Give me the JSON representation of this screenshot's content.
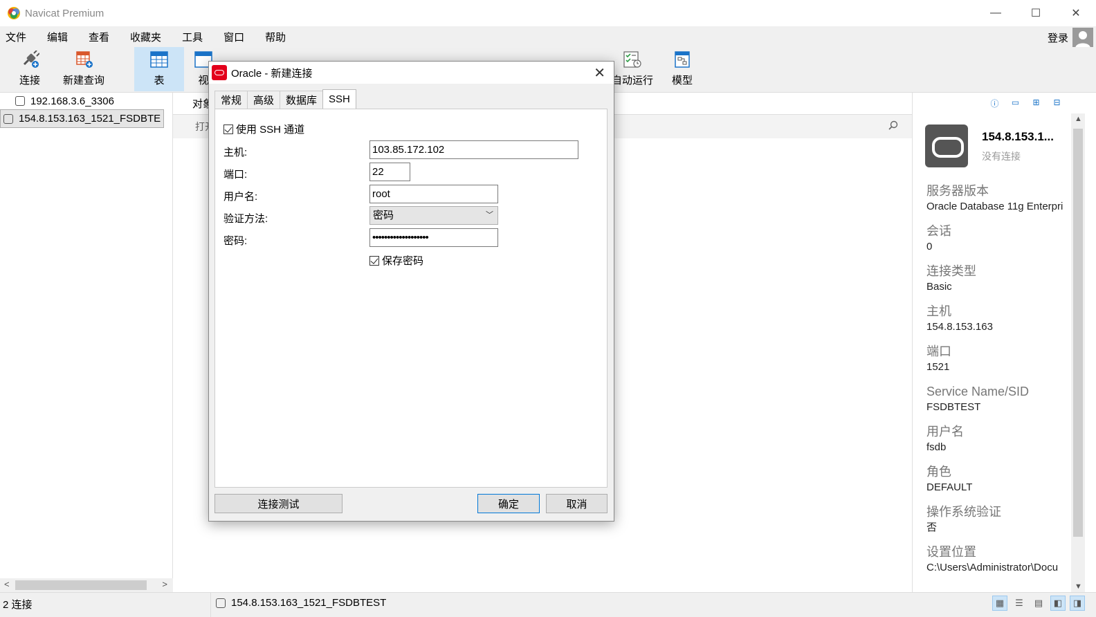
{
  "window": {
    "title": "Navicat Premium",
    "controls": [
      "—",
      "☐",
      "✕"
    ]
  },
  "menu": {
    "items": [
      "文件",
      "编辑",
      "查看",
      "收藏夹",
      "工具",
      "窗口",
      "帮助"
    ],
    "login": "登录"
  },
  "toolbar": {
    "items": [
      {
        "label": "连接"
      },
      {
        "label": "新建查询"
      },
      {
        "label": "表"
      },
      {
        "label": "视"
      },
      {
        "label": "自动运行"
      },
      {
        "label": "模型"
      }
    ]
  },
  "nav": {
    "connections": [
      "192.168.3.6_3306",
      "154.8.153.163_1521_FSDBTE"
    ]
  },
  "main": {
    "tab": "对象",
    "toolbar_open": "打开"
  },
  "dialog": {
    "title": "Oracle - 新建连接",
    "tabs": [
      "常规",
      "高级",
      "数据库",
      "SSH"
    ],
    "use_ssh": "使用 SSH 通道",
    "host_label": "主机:",
    "host_value": "103.85.172.102",
    "port_label": "端口:",
    "port_value": "22",
    "user_label": "用户名:",
    "user_value": "root",
    "auth_label": "验证方法:",
    "auth_value": "密码",
    "password_label": "密码:",
    "password_value": "•••••••••••••••••••",
    "save_password": "保存密码",
    "test_button": "连接测试",
    "ok_button": "确定",
    "cancel_button": "取消"
  },
  "info": {
    "name": "154.8.153.1...",
    "status": "没有连接",
    "fields": [
      {
        "label": "服务器版本",
        "value": "Oracle Database 11g Enterpri"
      },
      {
        "label": "会话",
        "value": "0"
      },
      {
        "label": "连接类型",
        "value": "Basic"
      },
      {
        "label": "主机",
        "value": "154.8.153.163"
      },
      {
        "label": "端口",
        "value": "1521"
      },
      {
        "label": "Service Name/SID",
        "value": "FSDBTEST"
      },
      {
        "label": "用户名",
        "value": "fsdb"
      },
      {
        "label": "角色",
        "value": "DEFAULT"
      },
      {
        "label": "操作系统验证",
        "value": "否"
      },
      {
        "label": "设置位置",
        "value": "C:\\Users\\Administrator\\Docu"
      }
    ]
  },
  "status": {
    "connections": "2 连接",
    "current": "154.8.153.163_1521_FSDBTEST"
  },
  "colors": {
    "accent": "#0078d7",
    "selected_tool": "#cce4f7",
    "oracle_red": "#e3001b"
  }
}
